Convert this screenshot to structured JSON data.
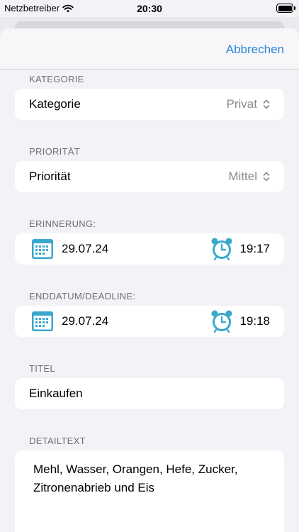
{
  "status": {
    "carrier": "Netzbetreiber",
    "time": "20:30"
  },
  "nav": {
    "cancel_label": "Abbrechen"
  },
  "category": {
    "section": "KATEGORIE",
    "label": "Kategorie",
    "value": "Privat"
  },
  "priority": {
    "section": "PRIORITÄT",
    "label": "Priorität",
    "value": "Mittel"
  },
  "reminder": {
    "section": "ERINNERUNG:",
    "date": "29.07.24",
    "time": "19:17"
  },
  "deadline": {
    "section": "ENDDATUM/DEADLINE:",
    "date": "29.07.24",
    "time": "19:18"
  },
  "title": {
    "section": "TITEL",
    "value": "Einkaufen"
  },
  "detail": {
    "section": "DETAILTEXT",
    "value": "Mehl, Wasser, Orangen, Hefe, Zucker, Zitronenabrieb und Eis"
  },
  "colors": {
    "accent": "#2c86d9",
    "icon": "#3aa8cc",
    "background": "#f2f2f7"
  }
}
